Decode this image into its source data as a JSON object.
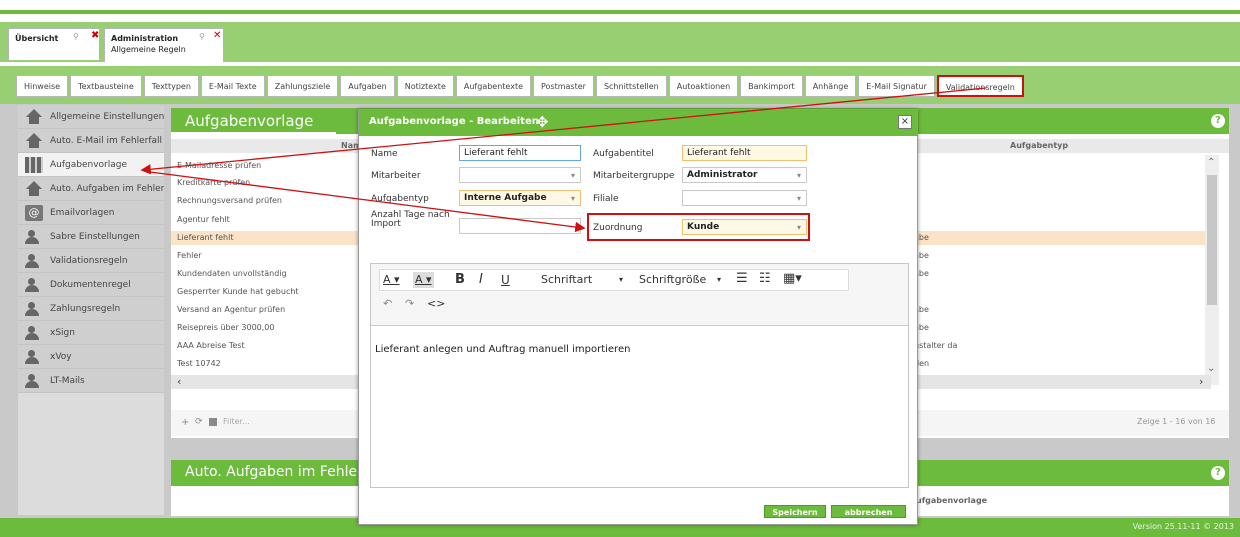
{
  "colors": {
    "accent": "#6cbb3c",
    "highlight": "#d01010"
  },
  "primary_tabs": [
    {
      "label": "Übersicht"
    },
    {
      "label": "Administration",
      "sub": "Allgemeine Regeln"
    }
  ],
  "sub_tabs": [
    "Hinweise",
    "Textbausteine",
    "Texttypen",
    "E-Mail Texte",
    "Zahlungsziele",
    "Aufgaben",
    "Notiztexte",
    "Aufgabentexte",
    "Postmaster",
    "Schnittstellen",
    "Autoaktionen",
    "Bankimport",
    "Anhänge",
    "E-Mail Signatur",
    "Validationsregeln"
  ],
  "sidebar": {
    "items": [
      {
        "label": "Allgemeine Einstellungen",
        "icon": "home-icon"
      },
      {
        "label": "Auto. E-Mail im Fehlerfall",
        "icon": "home-icon"
      },
      {
        "label": "Aufgabenvorlage",
        "icon": "tasks-icon"
      },
      {
        "label": "Auto. Aufgaben im Fehlerfall",
        "icon": "home-icon"
      },
      {
        "label": "Emailvorlagen",
        "icon": "at-icon"
      },
      {
        "label": "Sabre Einstellungen",
        "icon": "users-icon"
      },
      {
        "label": "Validationsregeln",
        "icon": "users-icon"
      },
      {
        "label": "Dokumentenregel",
        "icon": "users-icon"
      },
      {
        "label": "Zahlungsregeln",
        "icon": "users-icon"
      },
      {
        "label": "xSign",
        "icon": "users-icon"
      },
      {
        "label": "xVoy",
        "icon": "users-icon"
      },
      {
        "label": "LT-Mails",
        "icon": "users-icon"
      }
    ]
  },
  "panel": {
    "title": "Aufgabenvorlage",
    "col_name": "Name",
    "col_type": "Aufgabentyp",
    "rows": [
      {
        "name": "E-Mailadresse prüfen",
        "type": ""
      },
      {
        "name": "Kreditkarte prüfen",
        "type": ""
      },
      {
        "name": "Rechnungsversand prüfen",
        "type": ""
      },
      {
        "name": "Agentur fehlt",
        "type": ""
      },
      {
        "name": "Lieferant fehlt",
        "type": "abe"
      },
      {
        "name": "Fehler",
        "type": "abe"
      },
      {
        "name": "Kundendaten unvollständig",
        "type": "abe"
      },
      {
        "name": "Gesperrter Kunde hat gebucht",
        "type": ""
      },
      {
        "name": "Versand an Agentur prüfen",
        "type": "abe"
      },
      {
        "name": "Reisepreis über 3000,00",
        "type": "abe"
      },
      {
        "name": "AAA Abreise Test",
        "type": "nstalter da"
      },
      {
        "name": "Test 10742",
        "type": "den"
      }
    ],
    "filter_placeholder": "Filter...",
    "pager": "Zeige 1 - 16 von 16"
  },
  "panel2": {
    "title": "Auto. Aufgaben im Fehlerfall",
    "col_type": "ufgabenvorlage"
  },
  "footer": "Version 25.11-11 © 2013",
  "modal": {
    "title": "Aufgabenvorlage - Bearbeiten",
    "fields": {
      "name_label": "Name",
      "name_value": "Lieferant fehlt",
      "title_label": "Aufgabentitel",
      "title_value": "Lieferant fehlt",
      "mitarbeiter_label": "Mitarbeiter",
      "mitarbeiter_value": "",
      "gruppe_label": "Mitarbeitergruppe",
      "gruppe_value": "Administrator",
      "typ_label": "Aufgabentyp",
      "typ_value": "Interne Aufgabe",
      "filiale_label": "Filiale",
      "filiale_value": "",
      "tage_label": "Anzahl Tage nach Import",
      "tage_value": "",
      "zuordnung_label": "Zuordnung",
      "zuordnung_value": "Kunde"
    },
    "toolbar": {
      "font": "Schriftart",
      "size": "Schriftgröße"
    },
    "editor_text": "Lieferant anlegen und Auftrag manuell importieren",
    "save": "Speichern",
    "cancel": "abbrechen"
  }
}
